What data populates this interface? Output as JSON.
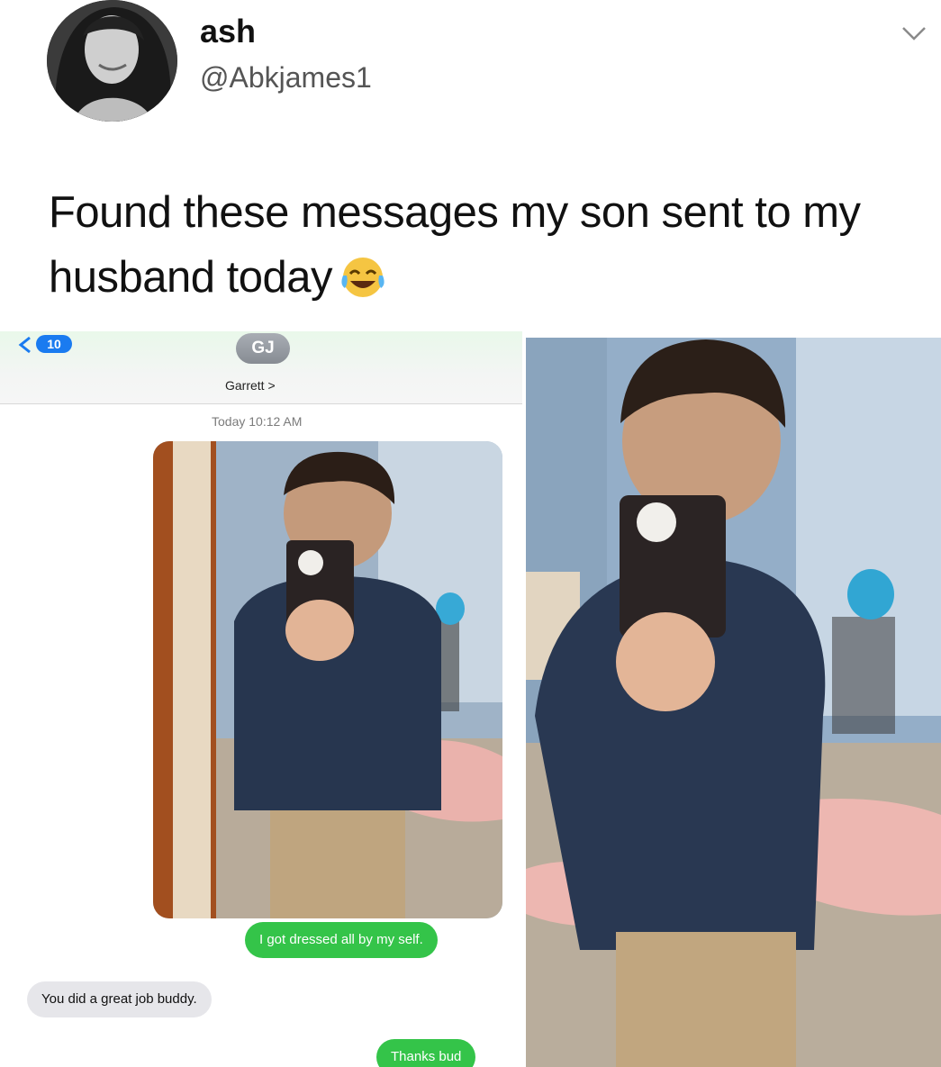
{
  "tweet": {
    "name": "ash",
    "handle": "@Abkjames1",
    "text": "Found these messages my son sent to my husband today",
    "emoji": "face-with-tears-of-joy"
  },
  "messages": {
    "back_badge": "10",
    "contact_initials": "GJ",
    "contact_name": "Garrett >",
    "timestamp": "Today 10:12 AM",
    "bubbles": [
      {
        "from": "me",
        "text": "I got dressed all by my self."
      },
      {
        "from": "them",
        "text": "You did a great job buddy."
      },
      {
        "from": "me",
        "text": "Thanks bud"
      }
    ]
  },
  "colors": {
    "sent_bubble": "#34c449",
    "received_bubble": "#e6e6ea",
    "badge": "#1a7bf0"
  }
}
